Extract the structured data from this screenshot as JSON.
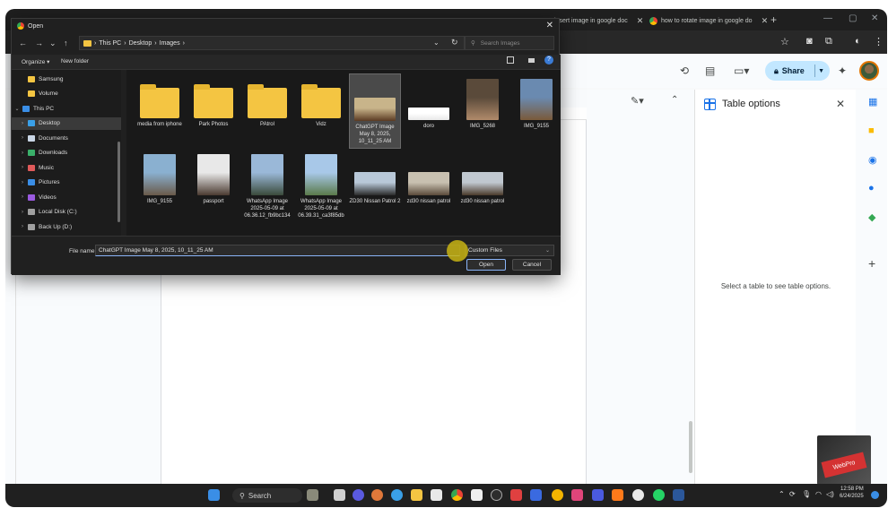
{
  "browser": {
    "tabs": [
      {
        "title": "insert image in google doc"
      },
      {
        "title": "how to rotate image in google do"
      }
    ]
  },
  "docs": {
    "share_label": "Share",
    "side_panel": {
      "title": "Table options",
      "message": "Select a table to see table options."
    }
  },
  "dialog": {
    "title": "Open",
    "path": [
      "This PC",
      "Desktop",
      "Images"
    ],
    "search_placeholder": "Search Images",
    "organize_label": "Organize",
    "new_folder_label": "New folder",
    "nav_items": [
      {
        "label": "Samsung",
        "color": "#f4c542",
        "indent": true,
        "chev": ""
      },
      {
        "label": "Volume",
        "color": "#f4c542",
        "indent": true,
        "chev": ""
      },
      {
        "label": "This PC",
        "color": "#3a8ee6",
        "indent": false,
        "chev": "⌄"
      },
      {
        "label": "Desktop",
        "color": "#3aa0e8",
        "indent": true,
        "chev": "›",
        "selected": true
      },
      {
        "label": "Documents",
        "color": "#c9d6e6",
        "indent": true,
        "chev": "›"
      },
      {
        "label": "Downloads",
        "color": "#3ab06a",
        "indent": true,
        "chev": "›"
      },
      {
        "label": "Music",
        "color": "#e05a5a",
        "indent": true,
        "chev": "›"
      },
      {
        "label": "Pictures",
        "color": "#3a8ee6",
        "indent": true,
        "chev": "›"
      },
      {
        "label": "Videos",
        "color": "#9a5ae0",
        "indent": true,
        "chev": "›"
      },
      {
        "label": "Local Disk (C:)",
        "color": "#a0a0a0",
        "indent": true,
        "chev": "›"
      },
      {
        "label": "Back Up (D:)",
        "color": "#a0a0a0",
        "indent": true,
        "chev": "›"
      }
    ],
    "files": [
      {
        "label": "media from iphone",
        "kind": "folder"
      },
      {
        "label": "Park Photos",
        "kind": "folder"
      },
      {
        "label": "PAtrol",
        "kind": "folder"
      },
      {
        "label": "Vidz",
        "kind": "folder"
      },
      {
        "label": "ChatGPT Image May 8, 2025, 10_11_25 AM",
        "kind": "photo",
        "c1": "#c8b48a",
        "c2": "#5a3a22",
        "selected": true
      },
      {
        "label": "doro",
        "kind": "photo",
        "c1": "#ffffff",
        "c2": "#e8e8e8"
      },
      {
        "label": "IMG_5268",
        "kind": "photo",
        "c1": "#5a4a3a",
        "c2": "#b08a6a"
      },
      {
        "label": "IMG_9155",
        "kind": "photo",
        "c1": "#6a8ab0",
        "c2": "#7a5a3a"
      },
      {
        "label": "IMG_9155",
        "kind": "photo",
        "c1": "#8ab0d0",
        "c2": "#6a5a4a"
      },
      {
        "label": "passport",
        "kind": "photo",
        "c1": "#e8e8e8",
        "c2": "#4a3a30"
      },
      {
        "label": "WhatsApp Image 2025-05-09 at 06.36.12_fb9bc134",
        "kind": "photo",
        "c1": "#9ab8d8",
        "c2": "#3a4a3a"
      },
      {
        "label": "WhatsApp Image 2025-05-09 at 06.39.31_ca3f85db",
        "kind": "photo",
        "c1": "#a8c8e8",
        "c2": "#5a7a4a"
      },
      {
        "label": "ZD30 Nissan Patrol 2",
        "kind": "photo",
        "c1": "#b8c8d8",
        "c2": "#2a2a2a"
      },
      {
        "label": "zd30 nissan patrol",
        "kind": "photo",
        "c1": "#c8c0b0",
        "c2": "#5a4a3a"
      },
      {
        "label": "zd30 nissan patrol",
        "kind": "photo",
        "c1": "#c0c8d0",
        "c2": "#4a3a2a"
      }
    ],
    "file_name_label": "File name:",
    "file_name_value": "ChatGPT Image May 8, 2025, 10_11_25 AM",
    "file_type": "Custom Files",
    "open_label": "Open",
    "cancel_label": "Cancel"
  },
  "taskbar": {
    "search_label": "Search",
    "time": "12:58 PM",
    "date": "6/24/2025",
    "webcam_text": "WebPro"
  }
}
